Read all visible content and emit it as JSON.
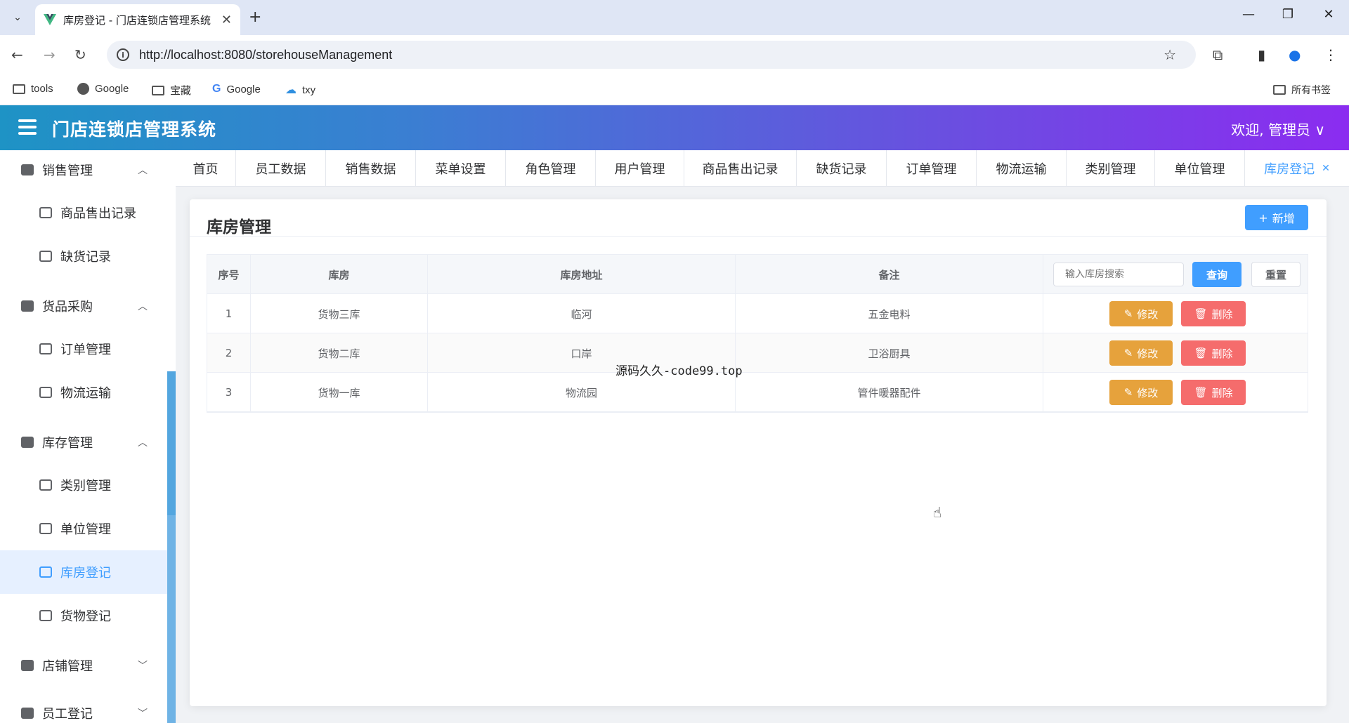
{
  "browser": {
    "tab_title": "库房登记 - 门店连锁店管理系统",
    "tab_close": "✕",
    "new_tab": "+",
    "url": "http://localhost:8080/storehouseManagement",
    "bookmarks": [
      {
        "label": "tools",
        "icon": "folder-icon"
      },
      {
        "label": "Google",
        "icon": "globe-icon"
      },
      {
        "label": "宝藏",
        "icon": "folder-icon"
      },
      {
        "label": "Google",
        "icon": "google-icon"
      },
      {
        "label": "txy",
        "icon": "cloud-icon"
      }
    ],
    "all_bookmarks": "所有书签"
  },
  "header": {
    "title": "门店连锁店管理系统",
    "welcome": "欢迎, 管理员 ∨"
  },
  "sidebar": {
    "groups": [
      {
        "label": "销售管理",
        "chevron": "︿",
        "items": [
          "商品售出记录",
          "缺货记录"
        ]
      },
      {
        "label": "货品采购",
        "chevron": "︿",
        "items": [
          "订单管理",
          "物流运输"
        ]
      },
      {
        "label": "库存管理",
        "chevron": "︿",
        "items": [
          "类别管理",
          "单位管理",
          "库房登记",
          "货物登记"
        ]
      },
      {
        "label": "店铺管理",
        "chevron": "﹀",
        "items": []
      },
      {
        "label": "员工登记",
        "chevron": "﹀",
        "items": []
      }
    ],
    "active_item": "库房登记"
  },
  "tags": [
    "首页",
    "员工数据",
    "销售数据",
    "菜单设置",
    "角色管理",
    "用户管理",
    "商品售出记录",
    "缺货记录",
    "订单管理",
    "物流运输",
    "类别管理",
    "单位管理",
    "库房登记"
  ],
  "main": {
    "title": "库房管理",
    "add_button": "新增",
    "table": {
      "headers": [
        "序号",
        "库房",
        "库房地址",
        "备注"
      ],
      "search_placeholder": "输入库房搜索",
      "query_button": "查询",
      "reset_button": "重置",
      "edit_label": "修改",
      "delete_label": "删除",
      "rows": [
        {
          "index": "1",
          "name": "货物三库",
          "address": "临河",
          "remark": "五金电料"
        },
        {
          "index": "2",
          "name": "货物二库",
          "address": "口岸",
          "remark": "卫浴厨具"
        },
        {
          "index": "3",
          "name": "货物一库",
          "address": "物流园",
          "remark": "管件暖器配件"
        }
      ]
    }
  },
  "overlay_text": "源码久久-code99.top"
}
